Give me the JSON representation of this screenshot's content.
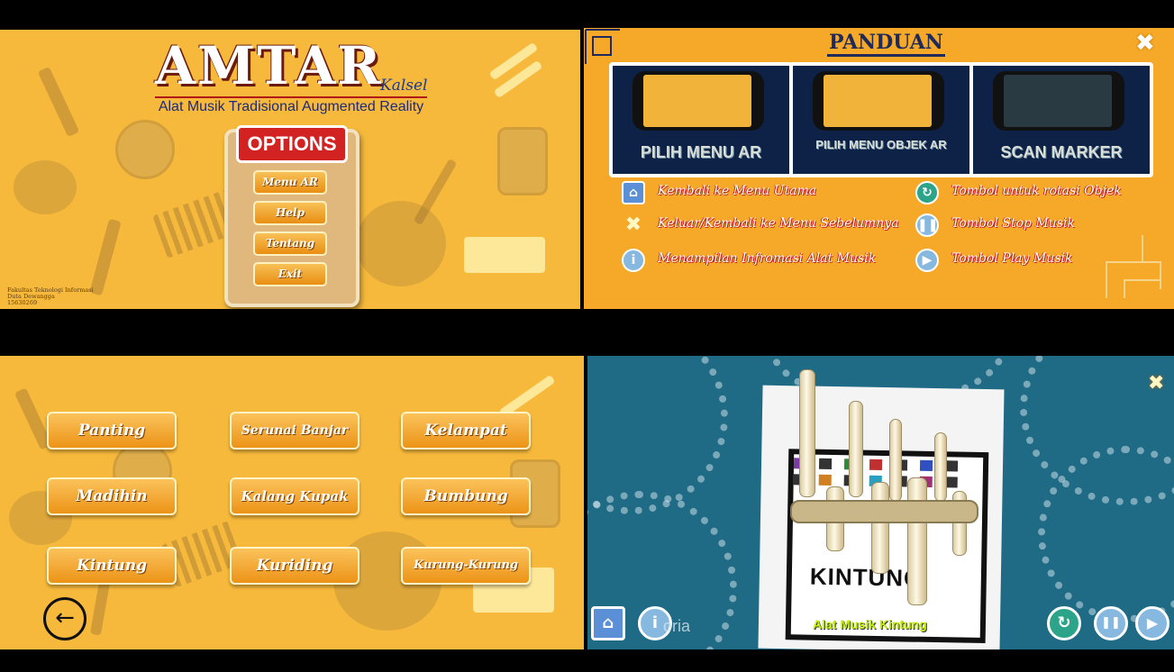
{
  "panel_menu": {
    "logo": "AMTAR",
    "logo_region": "Kalsel",
    "tagline": "Alat Musik Tradisional Augmented Reality",
    "options_title": "OPTIONS",
    "buttons": [
      "Menu AR",
      "Help",
      "Tentang",
      "Exit"
    ],
    "credits": [
      "Fakultas Teknologi Informasi",
      "Duta Dewangga",
      "15630269"
    ]
  },
  "panel_guide": {
    "title": "PANDUAN",
    "cards": [
      "PILIH MENU AR",
      "PILIH MENU OBJEK AR",
      "SCAN MARKER"
    ],
    "legend_left": [
      {
        "icon": "home-icon",
        "text": "Kembali ke Menu Utama"
      },
      {
        "icon": "close-icon",
        "text": "Keluar/Kembali ke Menu Sebelumnya"
      },
      {
        "icon": "info-icon",
        "text": "Menampilan Infromasi Alat Musik"
      }
    ],
    "legend_right": [
      {
        "icon": "rotate-icon",
        "text": "Tombol untuk rotasi Objek"
      },
      {
        "icon": "pause-icon",
        "text": "Tombol Stop Musik"
      },
      {
        "icon": "play-icon",
        "text": "Tombol Play Musik"
      }
    ]
  },
  "panel_instruments": {
    "items": [
      "Panting",
      "Serunai Banjar",
      "Kelampat",
      "Madihin",
      "Kalang Kupak",
      "Bumbung",
      "Kintung",
      "Kuriding",
      "Kurung-Kurung"
    ]
  },
  "panel_ar": {
    "marker_text": "KINTUNG",
    "caption": "Alat Musik Kintung",
    "watermark": "oria"
  }
}
